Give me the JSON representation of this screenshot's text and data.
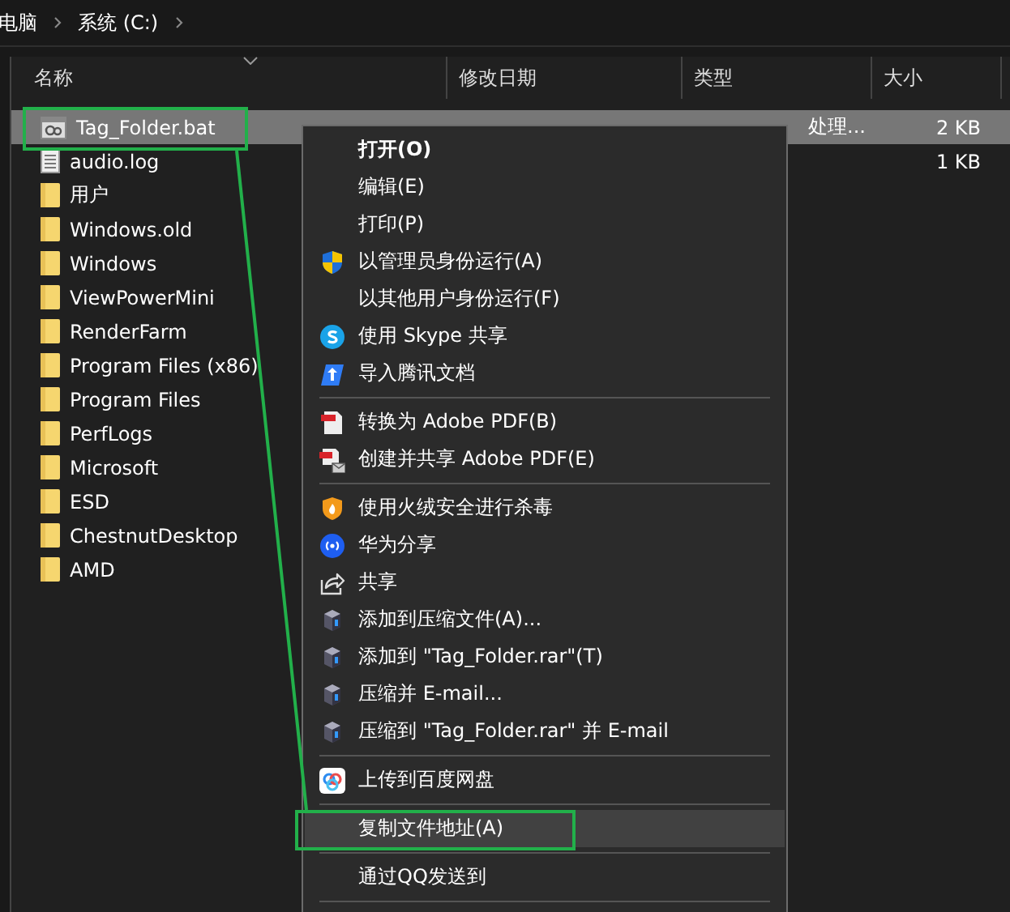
{
  "breadcrumb": [
    {
      "label": "电脑"
    },
    {
      "label": "系统 (C:)"
    }
  ],
  "columns": [
    {
      "label": "名称"
    },
    {
      "label": "修改日期"
    },
    {
      "label": "类型"
    },
    {
      "label": "大小"
    }
  ],
  "files": [
    {
      "name": "Tag_Folder.bat",
      "kind": "bat",
      "type": "处理...",
      "size": "2 KB",
      "selected": true
    },
    {
      "name": "audio.log",
      "kind": "log",
      "size": "1 KB",
      "selected": false
    },
    {
      "name": "用户",
      "kind": "folder",
      "selected": false
    },
    {
      "name": "Windows.old",
      "kind": "folder",
      "selected": false
    },
    {
      "name": "Windows",
      "kind": "folder",
      "selected": false
    },
    {
      "name": "ViewPowerMini",
      "kind": "folder",
      "selected": false
    },
    {
      "name": "RenderFarm",
      "kind": "folder",
      "selected": false
    },
    {
      "name": "Program Files (x86)",
      "kind": "folder",
      "selected": false
    },
    {
      "name": "Program Files",
      "kind": "folder",
      "selected": false
    },
    {
      "name": "PerfLogs",
      "kind": "folder",
      "selected": false
    },
    {
      "name": "Microsoft",
      "kind": "folder",
      "selected": false
    },
    {
      "name": "ESD",
      "kind": "folder",
      "selected": false
    },
    {
      "name": "ChestnutDesktop",
      "kind": "folder",
      "selected": false
    },
    {
      "name": "AMD",
      "kind": "folder",
      "selected": false
    }
  ],
  "context_menu": [
    {
      "kind": "plain",
      "label": "打开(O)",
      "bold": true,
      "highlighted": false
    },
    {
      "kind": "plain",
      "label": "编辑(E)",
      "bold": false,
      "highlighted": false
    },
    {
      "kind": "plain",
      "label": "打印(P)",
      "bold": false,
      "highlighted": false
    },
    {
      "kind": "shield",
      "label": "以管理员身份运行(A)",
      "bold": false,
      "highlighted": false
    },
    {
      "kind": "plain",
      "label": "以其他用户身份运行(F)",
      "bold": false,
      "highlighted": false
    },
    {
      "kind": "skype",
      "label": "使用 Skype 共享",
      "bold": false,
      "highlighted": false
    },
    {
      "kind": "tdoc",
      "label": "导入腾讯文档",
      "bold": false,
      "highlighted": false
    },
    {
      "kind": "separator"
    },
    {
      "kind": "pdf",
      "label": "转换为 Adobe PDF(B)",
      "bold": false,
      "highlighted": false
    },
    {
      "kind": "pdfmail",
      "label": "创建并共享 Adobe PDF(E)",
      "bold": false,
      "highlighted": false
    },
    {
      "kind": "separator"
    },
    {
      "kind": "huorong",
      "label": "使用火绒安全进行杀毒",
      "bold": false,
      "highlighted": false
    },
    {
      "kind": "huawei",
      "label": "华为分享",
      "bold": false,
      "highlighted": false
    },
    {
      "kind": "share",
      "label": "共享",
      "bold": false,
      "highlighted": false
    },
    {
      "kind": "rar",
      "label": "添加到压缩文件(A)...",
      "bold": false,
      "highlighted": false
    },
    {
      "kind": "rar",
      "label": "添加到 \"Tag_Folder.rar\"(T)",
      "bold": false,
      "highlighted": false
    },
    {
      "kind": "rar",
      "label": "压缩并 E-mail...",
      "bold": false,
      "highlighted": false
    },
    {
      "kind": "rar",
      "label": "压缩到 \"Tag_Folder.rar\" 并 E-mail",
      "bold": false,
      "highlighted": false
    },
    {
      "kind": "separator"
    },
    {
      "kind": "baidu",
      "label": "上传到百度网盘",
      "bold": false,
      "highlighted": false
    },
    {
      "kind": "separator"
    },
    {
      "kind": "plain",
      "label": "复制文件地址(A)",
      "bold": false,
      "highlighted": true
    },
    {
      "kind": "separator"
    },
    {
      "kind": "plain",
      "label": "通过QQ发送到",
      "bold": false,
      "highlighted": false
    },
    {
      "kind": "separator"
    }
  ]
}
